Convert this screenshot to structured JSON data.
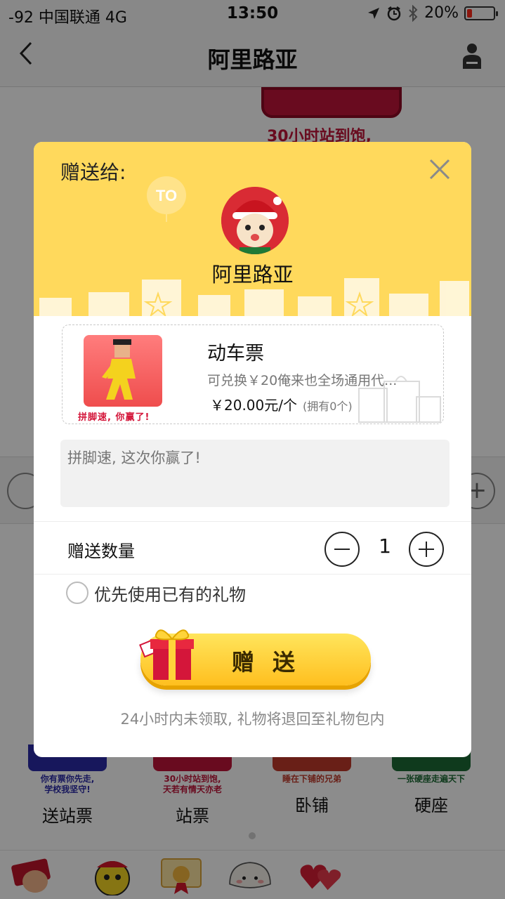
{
  "status_bar": {
    "carrier": "-92 中国联通  4G",
    "time": "13:50",
    "battery": "20%",
    "battery_level": 0.2
  },
  "nav": {
    "title": "阿里路亚",
    "back_icon": "chevron-left-icon",
    "profile_icon": "person-icon"
  },
  "background": {
    "sticker_top_text": "30小时站到饱,",
    "gifts": [
      {
        "name": "送站票",
        "caption": "你有票你先走,\n学校我坚守!",
        "color": "#2a2aa8"
      },
      {
        "name": "站票",
        "caption": "30小时站到饱,\n天若有情天亦老",
        "color": "#c0153a"
      },
      {
        "name": "卧铺",
        "caption": "睡在下铺的兄弟",
        "color": "#c0392b"
      },
      {
        "name": "硬座",
        "caption": "一张硬座走遍天下",
        "color": "#1d6b35"
      }
    ]
  },
  "dialog": {
    "send_to_label": "赠送给:",
    "recipient_name": "阿里路亚",
    "close_icon": "close-icon",
    "gift": {
      "title": "动车票",
      "description": "可兑换￥20俺来也全场通用代...",
      "price": "￥20.00元/个",
      "owned": "(拥有0个)",
      "image_caption": "拼脚速, 你赢了!"
    },
    "message_placeholder": "拼脚速, 这次你赢了!",
    "quantity": {
      "label": "赠送数量",
      "value": "1"
    },
    "prefer_owned_label": "优先使用已有的礼物",
    "send_button_label": "赠送",
    "note": "24小时内未领取, 礼物将退回至礼物包内"
  },
  "colors": {
    "header_yellow": "#ffd95c",
    "button_yellow": "#ffcf33",
    "accent_red": "#d4163a"
  }
}
